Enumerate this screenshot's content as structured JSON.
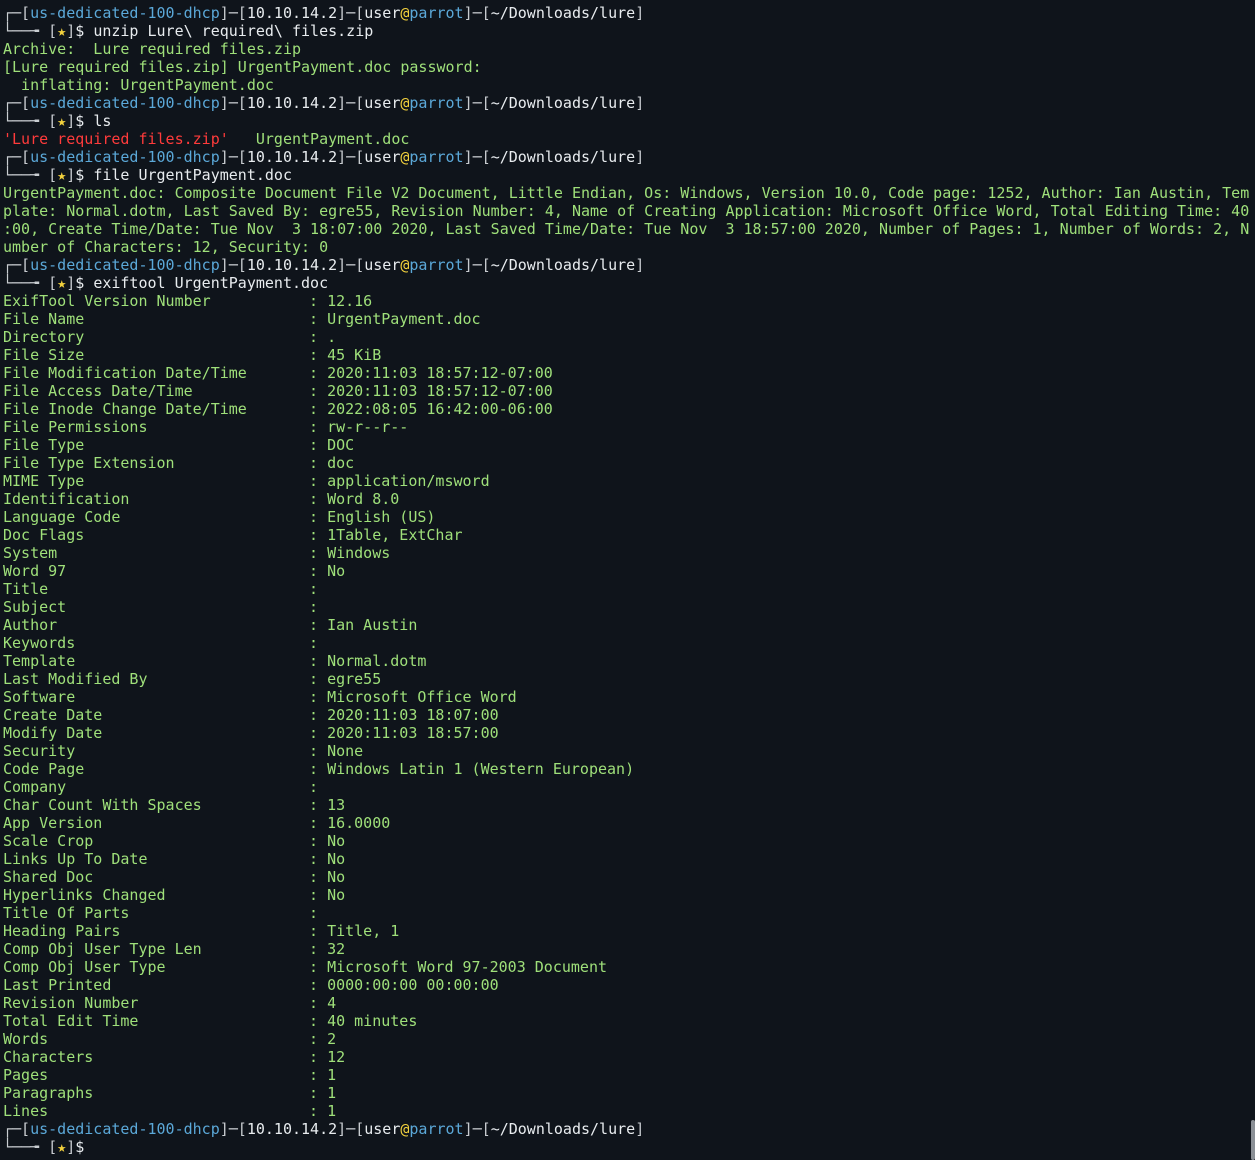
{
  "prompt": {
    "host": "us-dedicated-100-dhcp",
    "ip": "10.10.14.2",
    "user": "user",
    "at": "@",
    "machine": "parrot",
    "cwd": "~/Downloads/lure",
    "star": "★",
    "dollar": "$"
  },
  "cmds": {
    "unzip": "unzip Lure\\ required\\ files.zip",
    "ls": "ls",
    "file": "file UrgentPayment.doc",
    "exiftool": "exiftool UrgentPayment.doc"
  },
  "unzip_out": [
    "Archive:  Lure required files.zip",
    "[Lure required files.zip] UrgentPayment.doc password:",
    "  inflating: UrgentPayment.doc"
  ],
  "ls_out": {
    "zip": "'Lure required files.zip'",
    "doc": "   UrgentPayment.doc"
  },
  "file_out": [
    "UrgentPayment.doc: Composite Document File V2 Document, Little Endian, Os: Windows, Version 10.0, Code page: 1252, Author: Ian Austin, Tem",
    "plate: Normal.dotm, Last Saved By: egre55, Revision Number: 4, Name of Creating Application: Microsoft Office Word, Total Editing Time: 40",
    ":00, Create Time/Date: Tue Nov  3 18:07:00 2020, Last Saved Time/Date: Tue Nov  3 18:57:00 2020, Number of Pages: 1, Number of Words: 2, N",
    "umber of Characters: 12, Security: 0"
  ],
  "exif": [
    {
      "key": "ExifTool Version Number",
      "value": "12.16"
    },
    {
      "key": "File Name",
      "value": "UrgentPayment.doc"
    },
    {
      "key": "Directory",
      "value": "."
    },
    {
      "key": "File Size",
      "value": "45 KiB"
    },
    {
      "key": "File Modification Date/Time",
      "value": "2020:11:03 18:57:12-07:00"
    },
    {
      "key": "File Access Date/Time",
      "value": "2020:11:03 18:57:12-07:00"
    },
    {
      "key": "File Inode Change Date/Time",
      "value": "2022:08:05 16:42:00-06:00"
    },
    {
      "key": "File Permissions",
      "value": "rw-r--r--"
    },
    {
      "key": "File Type",
      "value": "DOC"
    },
    {
      "key": "File Type Extension",
      "value": "doc"
    },
    {
      "key": "MIME Type",
      "value": "application/msword"
    },
    {
      "key": "Identification",
      "value": "Word 8.0"
    },
    {
      "key": "Language Code",
      "value": "English (US)"
    },
    {
      "key": "Doc Flags",
      "value": "1Table, ExtChar"
    },
    {
      "key": "System",
      "value": "Windows"
    },
    {
      "key": "Word 97",
      "value": "No"
    },
    {
      "key": "Title",
      "value": ""
    },
    {
      "key": "Subject",
      "value": ""
    },
    {
      "key": "Author",
      "value": "Ian Austin"
    },
    {
      "key": "Keywords",
      "value": ""
    },
    {
      "key": "Template",
      "value": "Normal.dotm"
    },
    {
      "key": "Last Modified By",
      "value": "egre55"
    },
    {
      "key": "Software",
      "value": "Microsoft Office Word"
    },
    {
      "key": "Create Date",
      "value": "2020:11:03 18:07:00"
    },
    {
      "key": "Modify Date",
      "value": "2020:11:03 18:57:00"
    },
    {
      "key": "Security",
      "value": "None"
    },
    {
      "key": "Code Page",
      "value": "Windows Latin 1 (Western European)"
    },
    {
      "key": "Company",
      "value": ""
    },
    {
      "key": "Char Count With Spaces",
      "value": "13"
    },
    {
      "key": "App Version",
      "value": "16.0000"
    },
    {
      "key": "Scale Crop",
      "value": "No"
    },
    {
      "key": "Links Up To Date",
      "value": "No"
    },
    {
      "key": "Shared Doc",
      "value": "No"
    },
    {
      "key": "Hyperlinks Changed",
      "value": "No"
    },
    {
      "key": "Title Of Parts",
      "value": ""
    },
    {
      "key": "Heading Pairs",
      "value": "Title, 1"
    },
    {
      "key": "Comp Obj User Type Len",
      "value": "32"
    },
    {
      "key": "Comp Obj User Type",
      "value": "Microsoft Word 97-2003 Document"
    },
    {
      "key": "Last Printed",
      "value": "0000:00:00 00:00:00"
    },
    {
      "key": "Revision Number",
      "value": "4"
    },
    {
      "key": "Total Edit Time",
      "value": "40 minutes"
    },
    {
      "key": "Words",
      "value": "2"
    },
    {
      "key": "Characters",
      "value": "12"
    },
    {
      "key": "Pages",
      "value": "1"
    },
    {
      "key": "Paragraphs",
      "value": "1"
    },
    {
      "key": "Lines",
      "value": "1"
    }
  ]
}
